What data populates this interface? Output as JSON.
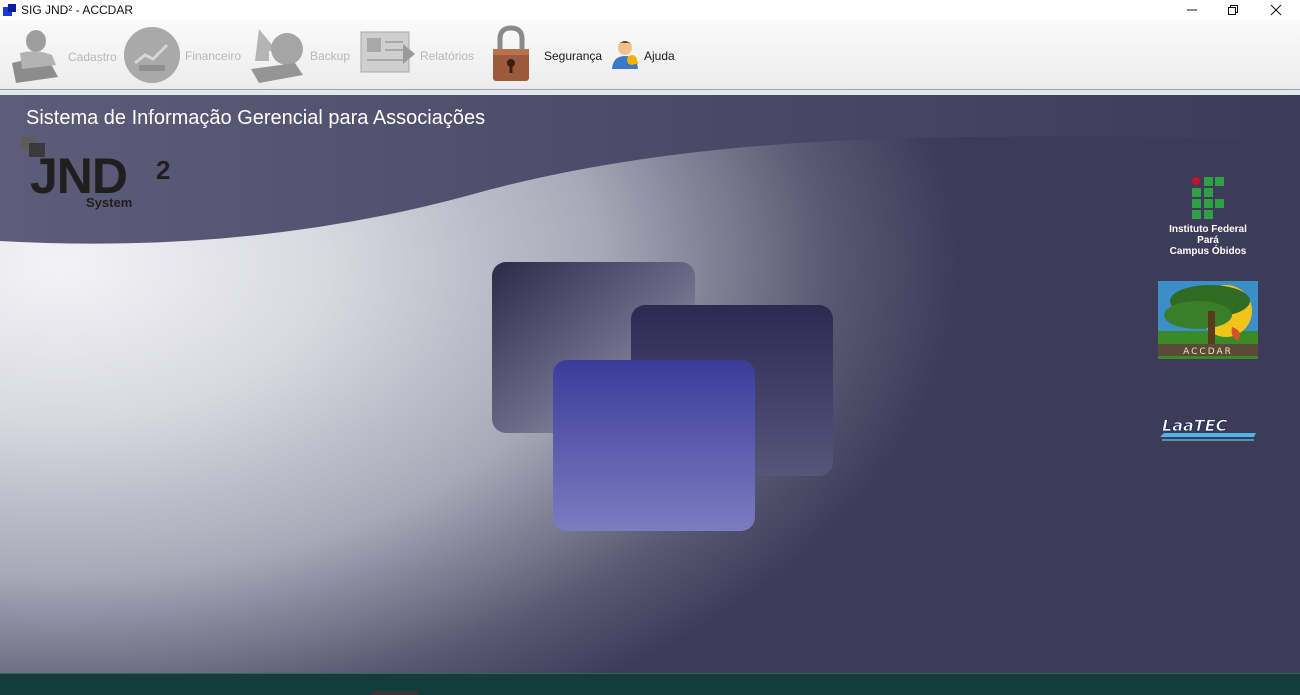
{
  "window": {
    "title": "SIG JND² - ACCDAR"
  },
  "toolbar": {
    "items": [
      {
        "label": "Cadastro",
        "icon": "cadastro-icon",
        "enabled": false
      },
      {
        "label": "Financeiro",
        "icon": "financeiro-icon",
        "enabled": false
      },
      {
        "label": "Backup",
        "icon": "backup-icon",
        "enabled": false
      },
      {
        "label": "Relatórios",
        "icon": "relatorios-icon",
        "enabled": false
      },
      {
        "label": "Segurança",
        "icon": "lock-icon",
        "enabled": true
      },
      {
        "label": "Ajuda",
        "icon": "user-help-icon",
        "enabled": true
      }
    ]
  },
  "main": {
    "system_title": "Sistema de Informação Gerencial para Associações",
    "logo": {
      "name": "JND",
      "superscript": "2",
      "subtitle": "System"
    },
    "partners": {
      "if_line1": "Instituto Federal",
      "if_line2": "Pará",
      "if_line3": "Campus Óbidos",
      "accdar_label": "ACCDAR",
      "laatec_label": "LaaTEC"
    }
  },
  "colors": {
    "status_bar": "#133d3a",
    "tile_dark": "#3a3a58",
    "tile_blue": "#4a4c9e",
    "if_green": "#2fa043",
    "if_red": "#c8102e"
  }
}
